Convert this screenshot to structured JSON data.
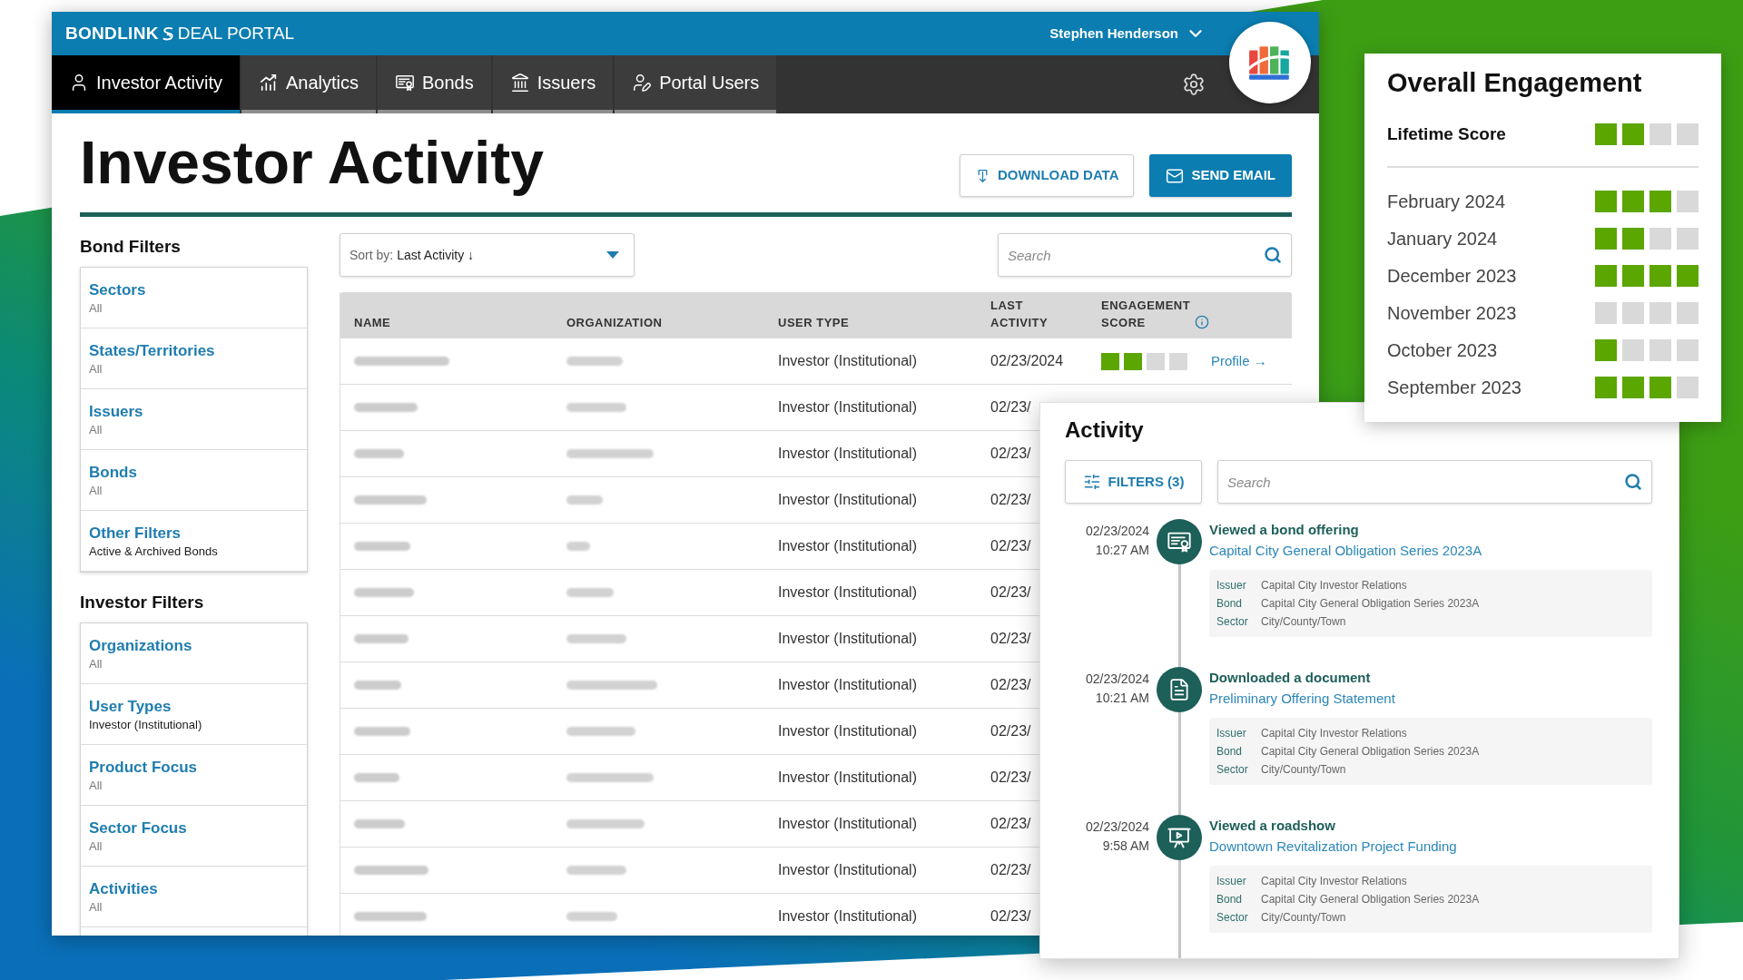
{
  "header": {
    "brand": "BONDLINK",
    "product": "DEAL PORTAL",
    "user": "Stephen Henderson"
  },
  "tabs": [
    {
      "label": "Investor Activity",
      "kind": "activity",
      "selected": true
    },
    {
      "label": "Analytics",
      "kind": "analytics",
      "selected": false
    },
    {
      "label": "Bonds",
      "kind": "bonds",
      "selected": false
    },
    {
      "label": "Issuers",
      "kind": "issuers",
      "selected": false
    },
    {
      "label": "Portal Users",
      "kind": "users",
      "selected": false
    }
  ],
  "page": {
    "title": "Investor Activity",
    "actions": [
      {
        "label": "DOWNLOAD DATA",
        "kind": "download"
      },
      {
        "label": "SEND EMAIL",
        "kind": "email"
      }
    ]
  },
  "bond_filters": {
    "heading": "Bond Filters",
    "items": [
      {
        "label": "Sectors",
        "value": "All",
        "applied": false
      },
      {
        "label": "States/Territories",
        "value": "All",
        "applied": false
      },
      {
        "label": "Issuers",
        "value": "All",
        "applied": false
      },
      {
        "label": "Bonds",
        "value": "All",
        "applied": false
      },
      {
        "label": "Other Filters",
        "value": "Active & Archived Bonds",
        "applied": true
      }
    ]
  },
  "investor_filters": {
    "heading": "Investor Filters",
    "items": [
      {
        "label": "Organizations",
        "value": "All",
        "applied": false
      },
      {
        "label": "User Types",
        "value": "Investor (Institutional)",
        "applied": true
      },
      {
        "label": "Product Focus",
        "value": "All",
        "applied": false
      },
      {
        "label": "Sector Focus",
        "value": "All",
        "applied": false
      },
      {
        "label": "Activities",
        "value": "All",
        "applied": false
      }
    ]
  },
  "sort": {
    "label": "Sort by:",
    "value": "Last Activity ↓"
  },
  "search": {
    "placeholder": "Search"
  },
  "table": {
    "columns": [
      {
        "label": "NAME",
        "kind": "plain"
      },
      {
        "label": "ORGANIZATION",
        "kind": "plain"
      },
      {
        "label": "USER TYPE",
        "kind": "plain"
      },
      {
        "label": "LAST ACTIVITY",
        "kind": "plain"
      },
      {
        "label": "ENGAGEMENT SCORE",
        "kind": "info"
      }
    ],
    "rows": [
      {
        "user_type": "Investor (Institutional)",
        "last_activity": "02/23/2024",
        "stars": 2,
        "link": "Profile →"
      },
      {
        "user_type": "Investor (Institutional)",
        "last_activity": "02/23/"
      },
      {
        "user_type": "Investor (Institutional)",
        "last_activity": "02/23/"
      },
      {
        "user_type": "Investor (Institutional)",
        "last_activity": "02/23/"
      },
      {
        "user_type": "Investor (Institutional)",
        "last_activity": "02/23/"
      },
      {
        "user_type": "Investor (Institutional)",
        "last_activity": "02/23/"
      },
      {
        "user_type": "Investor (Institutional)",
        "last_activity": "02/23/"
      },
      {
        "user_type": "Investor (Institutional)",
        "last_activity": "02/23/"
      },
      {
        "user_type": "Investor (Institutional)",
        "last_activity": "02/23/"
      },
      {
        "user_type": "Investor (Institutional)",
        "last_activity": "02/23/"
      },
      {
        "user_type": "Investor (Institutional)",
        "last_activity": "02/23/"
      },
      {
        "user_type": "Investor (Institutional)",
        "last_activity": "02/23/"
      },
      {
        "user_type": "Investor (Institutional)",
        "last_activity": "02/23/"
      }
    ]
  },
  "engagement": {
    "title": "Overall Engagement",
    "lifetime": {
      "label": "Lifetime Score",
      "stars": 2
    },
    "months": [
      {
        "label": "February 2024",
        "stars": 3
      },
      {
        "label": "January 2024",
        "stars": 2
      },
      {
        "label": "December 2023",
        "stars": 4
      },
      {
        "label": "November 2023",
        "stars": 0
      },
      {
        "label": "October 2023",
        "stars": 1
      },
      {
        "label": "September 2023",
        "stars": 3
      }
    ]
  },
  "activity": {
    "title": "Activity",
    "filters_button": "FILTERS (3)",
    "search": {
      "placeholder": "Search"
    },
    "entries": [
      {
        "date": "02/23/2024",
        "time": "10:27 AM",
        "kind": "offering",
        "action": "Viewed a bond offering",
        "link": "Capital City General Obligation Series 2023A",
        "details": [
          {
            "label": "Issuer",
            "value": "Capital City Investor Relations"
          },
          {
            "label": "Bond",
            "value": "Capital City General Obligation Series 2023A"
          },
          {
            "label": "Sector",
            "value": "City/County/Town"
          }
        ]
      },
      {
        "date": "02/23/2024",
        "time": "10:21 AM",
        "kind": "document",
        "action": "Downloaded a document",
        "link": "Preliminary Offering Statement",
        "details": [
          {
            "label": "Issuer",
            "value": "Capital City Investor Relations"
          },
          {
            "label": "Bond",
            "value": "Capital City General Obligation Series 2023A"
          },
          {
            "label": "Sector",
            "value": "City/County/Town"
          }
        ]
      },
      {
        "date": "02/23/2024",
        "time": "9:58 AM",
        "kind": "roadshow",
        "action": "Viewed a roadshow",
        "link": "Downtown Revitalization Project Funding",
        "details": [
          {
            "label": "Issuer",
            "value": "Capital City Investor Relations"
          },
          {
            "label": "Bond",
            "value": "Capital City General Obligation Series 2023A"
          },
          {
            "label": "Sector",
            "value": "City/County/Town"
          }
        ]
      }
    ]
  }
}
